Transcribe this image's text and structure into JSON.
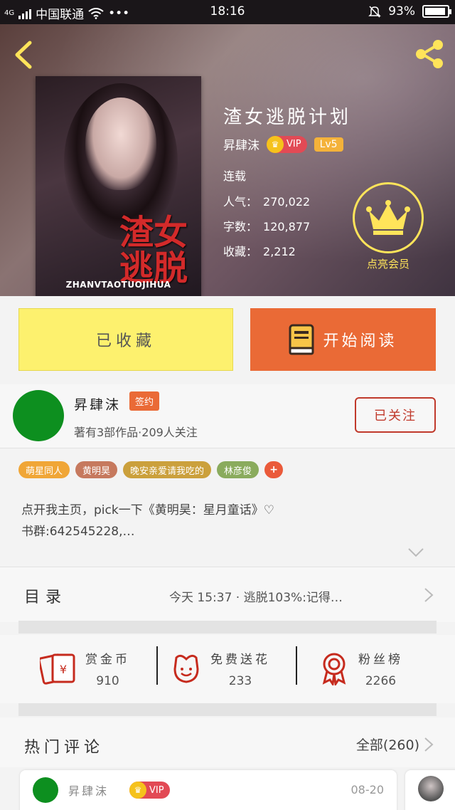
{
  "status_bar": {
    "network": "4G",
    "carrier": "中国联通",
    "more": "•••",
    "time": "18:16",
    "battery": "93%",
    "battery_level": 0.93
  },
  "book": {
    "cover_title": "渣女逃脱",
    "cover_pinyin": "ZHANVTAOTUOJIHUA",
    "title": "渣女逃脱计划",
    "author": "昇肆沫",
    "vip": "VIP",
    "level": "Lv5",
    "status": "连载",
    "stats": [
      {
        "label": "人气：",
        "value": "270,022"
      },
      {
        "label": "字数：",
        "value": "120,877"
      },
      {
        "label": "收藏：",
        "value": "2,212"
      }
    ],
    "member_label": "点亮会员"
  },
  "actions": {
    "collected": "已收藏",
    "read": "开始阅读"
  },
  "author_card": {
    "name": "昇肆沫",
    "badge": "签约",
    "meta": "著有3部作品·209人关注",
    "follow": "已关注"
  },
  "tags": [
    {
      "label": "萌星同人",
      "color": "#f0a637"
    },
    {
      "label": "黄明昊",
      "color": "#c6795e"
    },
    {
      "label": "晚安亲爱请我吃的",
      "color": "#cba03c"
    },
    {
      "label": "林彦俊",
      "color": "#8aab5d"
    },
    {
      "label": "+",
      "color": "#ea5a3a"
    }
  ],
  "description": {
    "line1": "点开我主页，pick一下《黄明昊：星月童话》♡",
    "line2": "书群:642545228,…"
  },
  "catalog": {
    "label": "目录",
    "update": "今天 15:37 · 逃脱103%:记得…"
  },
  "gifts": [
    {
      "label": "赏金币",
      "value": "910",
      "icon": "red-envelope-icon"
    },
    {
      "label": "免费送花",
      "value": "233",
      "icon": "flower-icon"
    },
    {
      "label": "粉丝榜",
      "value": "2266",
      "icon": "award-ribbon-icon"
    }
  ],
  "comments": {
    "title": "热门评论",
    "all": "全部(260)",
    "first": {
      "name": "昇肆沫",
      "vip": "VIP",
      "date": "08-20"
    }
  },
  "colors": {
    "accent_orange": "#ea6a36",
    "collect_yellow": "#fdf16e",
    "member_yellow": "#ffe45a",
    "follow_red": "#c0392b",
    "avatar_green": "#0d8f1f"
  }
}
